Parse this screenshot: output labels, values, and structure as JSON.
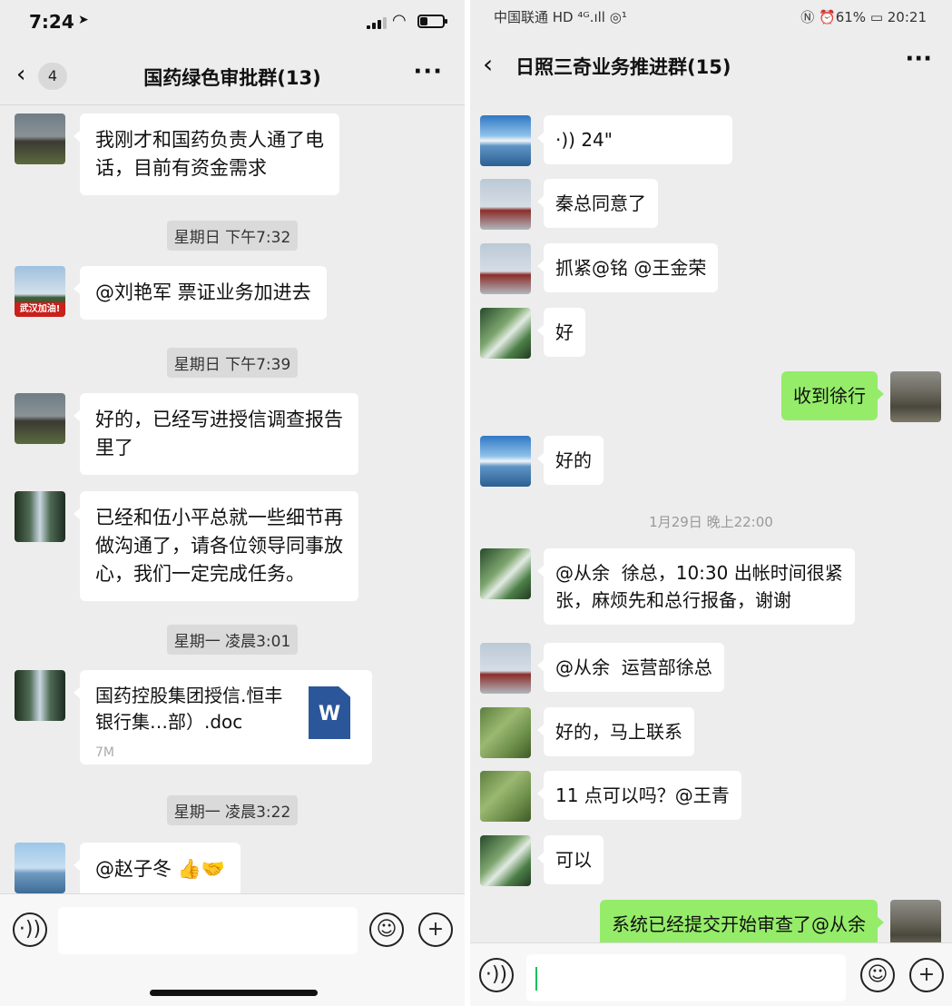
{
  "colors": {
    "chat_bg": "#ededed",
    "bubble_in": "#ffffff",
    "bubble_out": "#95ec69",
    "doc_blue": "#2b579a",
    "cursor_green": "#07c160"
  },
  "left": {
    "status": {
      "time": "7:24",
      "location_icon": "location-arrow-icon",
      "battery_fraction": 0.35
    },
    "nav": {
      "back_icon": "chevron-left-icon",
      "badge": "4",
      "title": "国药绿色审批群(13)",
      "more": "···"
    },
    "messages": [
      {
        "text": "我刚才和国药负责人通了电\n话，目前有资金需求",
        "avatar": "horses"
      },
      {
        "time": "星期日 下午7:32"
      },
      {
        "text": "@刘艳军 票证业务加进去",
        "avatar": "tree",
        "avatar_caption": "武汉加油!"
      },
      {
        "time": "星期日 下午7:39"
      },
      {
        "text": "好的，已经写进授信调查报告\n里了",
        "avatar": "horses"
      },
      {
        "text": "已经和伍小平总就一些细节再\n做沟通了，请各位领导同事放\n心，我们一定完成任务。",
        "avatar": "waterfall"
      },
      {
        "time": "星期一 凌晨3:01"
      },
      {
        "file_name": "国药控股集团授信.恒丰银行集…部）.doc",
        "file_size": "7M",
        "file_icon": "W",
        "avatar": "waterfall"
      },
      {
        "time": "星期一 凌晨3:22"
      },
      {
        "text": "@赵子冬 👍🤝",
        "avatar": "lake"
      }
    ],
    "input": {
      "voice_icon": "voice-icon",
      "emoji_icon": "emoji-icon",
      "plus_icon": "plus-icon"
    }
  },
  "right": {
    "status": {
      "carrier": "中国联通 HD ⁴ᴳ.ıll ◎¹",
      "right": "Ⓝ ⏰61% ▭ 20:21"
    },
    "nav": {
      "back_icon": "chevron-left-icon",
      "title": "日照三奇业务推进群(15)",
      "more": "···"
    },
    "messages": [
      {
        "voice": "·)) 24\"",
        "avatar": "mountain-lake"
      },
      {
        "text": "秦总同意了",
        "avatar": "gate"
      },
      {
        "text": "抓紧@铭 @王金荣",
        "avatar": "gate"
      },
      {
        "text": "好",
        "avatar": "plants"
      },
      {
        "text": "收到徐行",
        "out": true,
        "avatar": "pavilion"
      },
      {
        "text": "好的",
        "avatar": "mountain-lake"
      },
      {
        "time": "1月29日 晚上22:00"
      },
      {
        "text": "@从余  徐总，10:30 出帐时间很紧\n张，麻烦先和总行报备，谢谢",
        "avatar": "plants"
      },
      {
        "text": "@从余  运营部徐总",
        "avatar": "gate"
      },
      {
        "text": "好的，马上联系",
        "avatar": "grass"
      },
      {
        "text": "11 点可以吗？@王青",
        "avatar": "grass"
      },
      {
        "text": "可以",
        "avatar": "plants"
      },
      {
        "text": "系统已经提交开始审查了@从余",
        "out": true,
        "avatar": "pavilion"
      }
    ],
    "input": {
      "voice_icon": "voice-icon",
      "emoji_icon": "emoji-icon",
      "plus_icon": "plus-icon"
    }
  }
}
